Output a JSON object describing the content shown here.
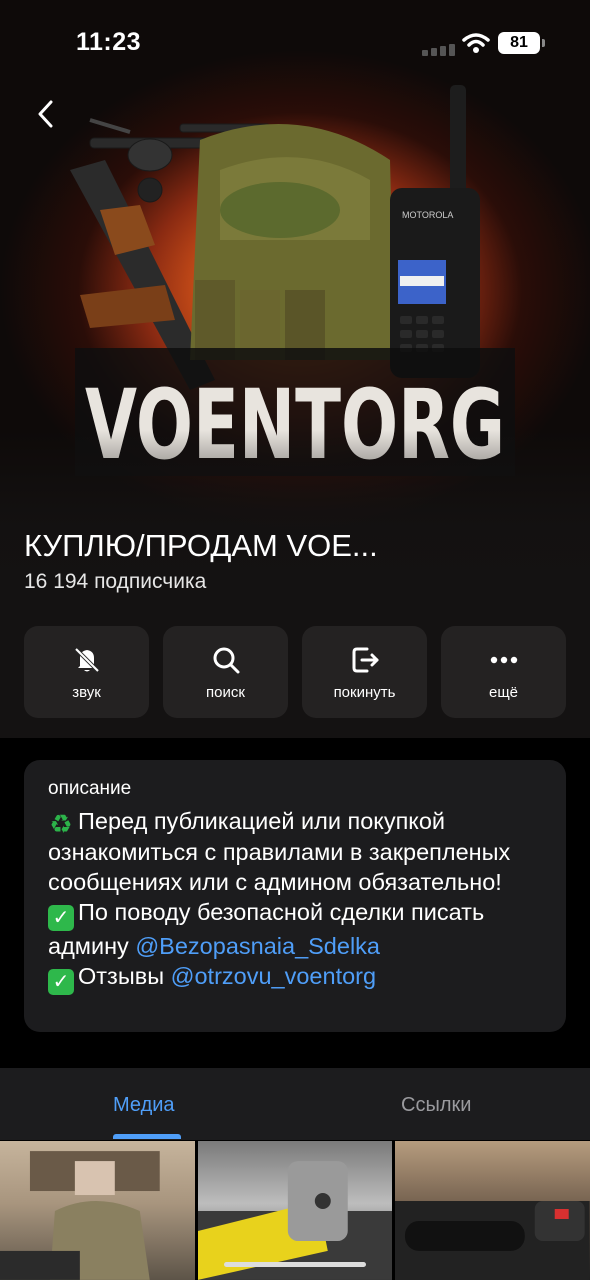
{
  "status": {
    "time": "11:23",
    "battery": "81"
  },
  "hero": {
    "logo_text": "VOENTORG",
    "radio_brand": "MOTOROLA"
  },
  "channel": {
    "title": "КУПЛЮ/ПРОДАМ VOE...",
    "subscribers": "16 194 подписчика"
  },
  "actions": [
    {
      "label": "звук",
      "icon": "bell-slash-icon"
    },
    {
      "label": "поиск",
      "icon": "search-icon"
    },
    {
      "label": "покинуть",
      "icon": "leave-icon"
    },
    {
      "label": "ещё",
      "icon": "more-icon"
    }
  ],
  "description": {
    "label": "описание",
    "line1": "Перед публикацией или покупкой ознакомиться с правилами в закрепленых сообщениях или с админом обязательно!",
    "line2": "По поводу безопасной сделки писать админу ",
    "mention1": "@Bezopasnaia_Sdelka",
    "line3": "Отзывы ",
    "mention2": "@otrzovu_voentorg"
  },
  "tabs": [
    {
      "label": "Медиа",
      "active": true
    },
    {
      "label": "Ссылки",
      "active": false
    }
  ],
  "colors": {
    "accent": "#4f9ef8",
    "card": "#1c1c1e",
    "check_green": "#2eb84b"
  }
}
